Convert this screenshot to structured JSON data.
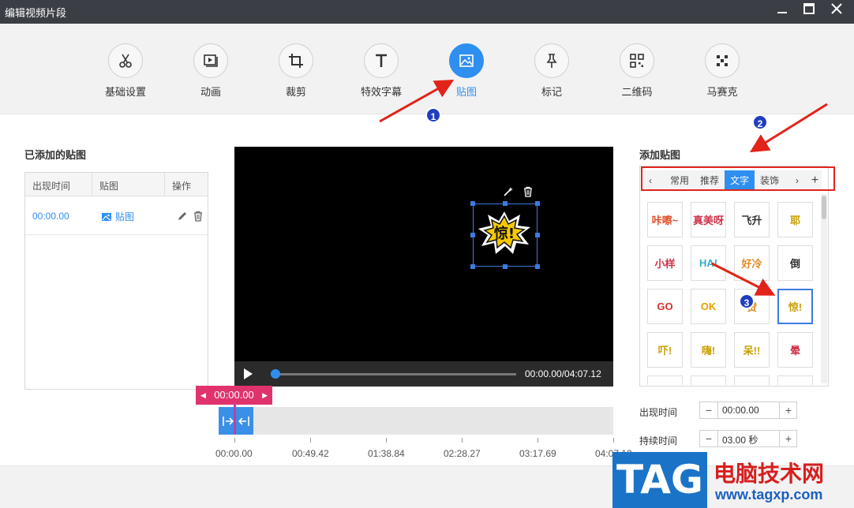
{
  "window": {
    "title": "编辑视频片段",
    "minimize_icon": "minimize-icon",
    "maximize_icon": "maximize-icon",
    "close_icon": "close-icon"
  },
  "toolbar": {
    "items": [
      {
        "label": "基础设置",
        "icon": "scissors-icon"
      },
      {
        "label": "动画",
        "icon": "play-frame-icon"
      },
      {
        "label": "裁剪",
        "icon": "crop-icon"
      },
      {
        "label": "特效字幕",
        "icon": "text-icon"
      },
      {
        "label": "贴图",
        "icon": "image-icon",
        "active": true
      },
      {
        "label": "标记",
        "icon": "pin-icon"
      },
      {
        "label": "二维码",
        "icon": "qrcode-icon"
      },
      {
        "label": "马赛克",
        "icon": "mosaic-icon"
      }
    ]
  },
  "added_stickers": {
    "title": "已添加的贴图",
    "columns": [
      "出现时间",
      "贴图",
      "操作"
    ],
    "rows": [
      {
        "time": "00:00.00",
        "sticker": "贴图"
      }
    ]
  },
  "player": {
    "time": "00:00.00/04:07.12",
    "progress": 0
  },
  "timeline": {
    "current": "00:00.00",
    "ticks": [
      "00:00.00",
      "00:49.42",
      "01:38.84",
      "02:28.27",
      "03:17.69",
      "04:07.12"
    ]
  },
  "library": {
    "title": "添加贴图",
    "tabs": [
      "常用",
      "推荐",
      "文字",
      "装饰"
    ],
    "selected_tab": "文字",
    "stickers": [
      [
        "咔嚓~",
        "真美呀",
        "飞升",
        "耶"
      ],
      [
        "小样",
        "HA!",
        "好冷",
        "倒"
      ],
      [
        "GO",
        "OK",
        "赞",
        "惊!"
      ],
      [
        "吓!",
        "嗨!",
        "呆!!",
        "晕"
      ]
    ]
  },
  "fields": {
    "appear_label": "出现时间",
    "appear_value": "00:00.00",
    "duration_label": "持续时间",
    "duration_value": "03.00 秒"
  },
  "annotations": {
    "badge1": "1",
    "badge2": "2",
    "badge3": "3",
    "color": "#e2231a"
  },
  "watermark": {
    "logo": "TAG",
    "name": "电脑技术网",
    "url": "www.tagxp.com"
  }
}
